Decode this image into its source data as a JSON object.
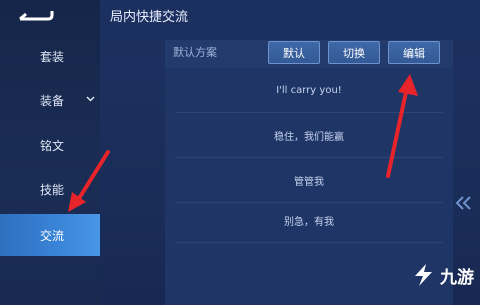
{
  "sidebar": {
    "items": [
      {
        "label": "套装"
      },
      {
        "label": "装备"
      },
      {
        "label": "铭文"
      },
      {
        "label": "技能"
      },
      {
        "label": "交流"
      }
    ]
  },
  "header": {
    "title": "局内快捷交流"
  },
  "panel": {
    "preset_label": "默认方案",
    "buttons": {
      "default": "默认",
      "switch": "切换",
      "edit": "编辑"
    },
    "messages": [
      "I'll carry you!",
      "稳住，我们能赢",
      "管管我",
      "别急，有我"
    ]
  },
  "colors": {
    "accent": "#3a85d8",
    "annotation_arrow": "#e8242b"
  },
  "icons": [
    "back-arrow-icon",
    "chevron-down-icon",
    "double-chevron-left-icon",
    "jiuyou-logo-icon"
  ]
}
